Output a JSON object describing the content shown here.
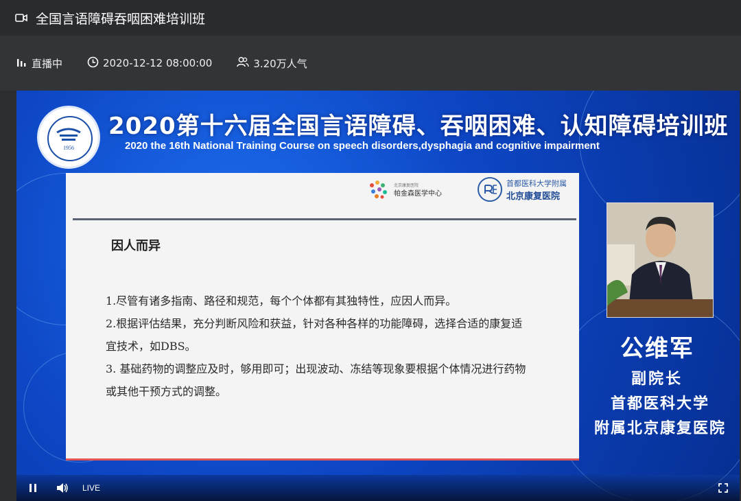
{
  "window": {
    "title": "全国言语障碍吞咽困难培训班"
  },
  "info": {
    "status": "直播中",
    "datetime": "2020-12-12 08:00:00",
    "popularity": "3.20万人气"
  },
  "slide": {
    "banner_cn": "2020第十六届全国言语障碍、吞咽困难、认知障碍培训班",
    "banner_en": "2020 the 16th National Training Course on speech disorders,dysphagia and cognitive impairment",
    "logo_year": "1956",
    "ppt": {
      "logo_a_small": "北京康复医院",
      "logo_a_text": "帕金森医学中心",
      "logo_b_top": "首都医科大学附属",
      "logo_b_main": "北京康复医院",
      "heading": "因人而异",
      "p1": "1.尽管有诸多指南、路径和规范，每个个体都有其独特性，应因人而异。",
      "p2": "2.根据评估结果，充分判断风险和获益，针对各种各样的功能障碍，选择合适的康复适宜技术，如DBS。",
      "p3": "3. 基础药物的调整应及时，够用即可；出现波动、冻结等现象要根据个体情况进行药物或其他干预方式的调整。"
    },
    "speaker": {
      "name": "公维军",
      "title": "副院长",
      "org1": "首都医科大学",
      "org2": "附属北京康复医院"
    }
  },
  "controls": {
    "live_label": "LIVE"
  },
  "colors": {
    "accent": "#0d46c4",
    "progress": "#e15555"
  }
}
